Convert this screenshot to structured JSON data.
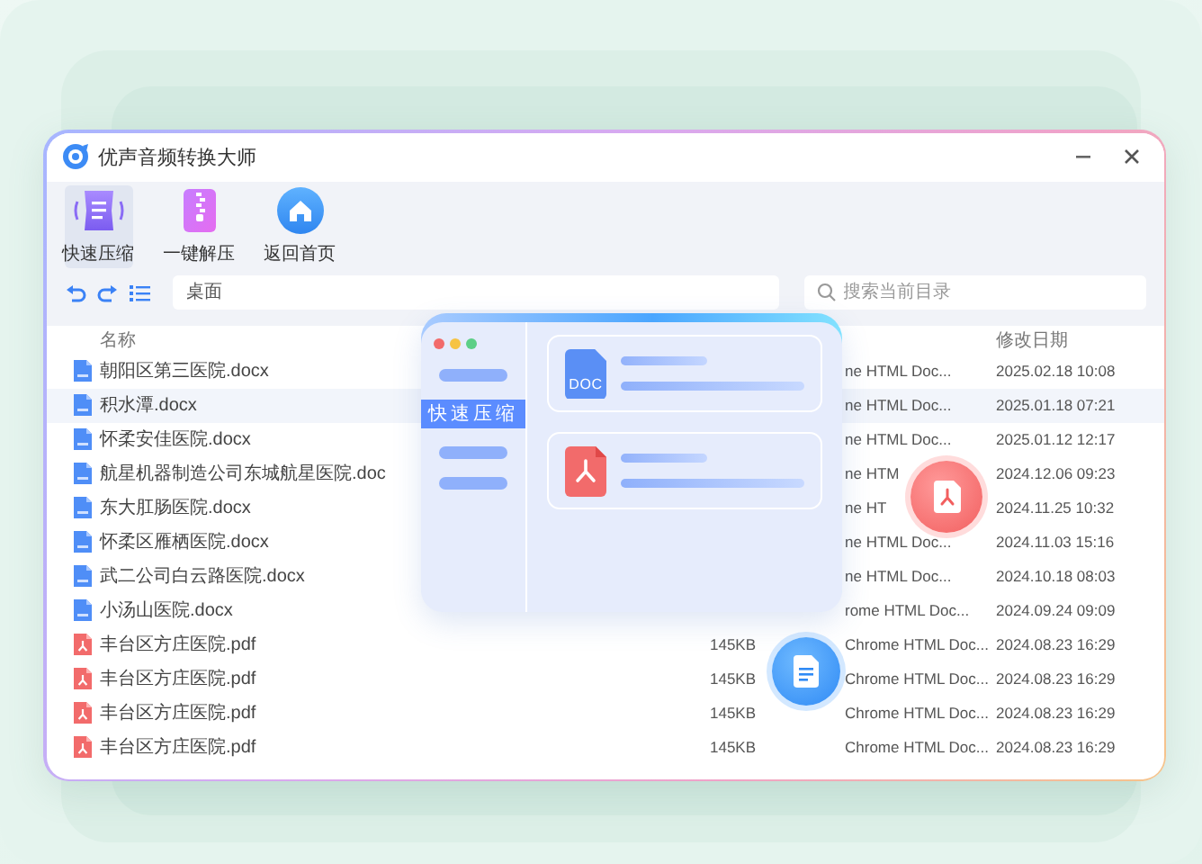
{
  "window": {
    "title": "优声音频转换大师"
  },
  "toolbar": [
    {
      "label": "快速压缩",
      "kind": "compress",
      "selected": true
    },
    {
      "label": "一键解压",
      "kind": "extract",
      "selected": false
    },
    {
      "label": "返回首页",
      "kind": "home",
      "selected": false
    }
  ],
  "path_field": {
    "value": "桌面"
  },
  "search": {
    "placeholder": "搜索当前目录"
  },
  "file_list": {
    "header": {
      "name": "名称",
      "date": "修改日期"
    },
    "rows": [
      {
        "kind": "doc",
        "name": "朝阳区第三医院.docx",
        "type": "ne HTML Doc...",
        "date": "2025.02.18 10:08",
        "selected": false
      },
      {
        "kind": "doc",
        "name": "积水潭.docx",
        "type": "ne HTML Doc...",
        "date": "2025.01.18 07:21",
        "selected": true
      },
      {
        "kind": "doc",
        "name": "怀柔安佳医院.docx",
        "type": "ne HTML Doc...",
        "date": "2025.01.12 12:17",
        "selected": false
      },
      {
        "kind": "doc",
        "name": "航星机器制造公司东城航星医院.doc",
        "type": "ne HTM",
        "date": "2024.12.06 09:23",
        "selected": false
      },
      {
        "kind": "doc",
        "name": "东大肛肠医院.docx",
        "type": "ne HT",
        "date": "2024.11.25 10:32",
        "selected": false
      },
      {
        "kind": "doc",
        "name": "怀柔区雁栖医院.docx",
        "type": "ne HTML Doc...",
        "date": "2024.11.03 15:16",
        "selected": false
      },
      {
        "kind": "doc",
        "name": "武二公司白云路医院.docx",
        "type": "ne HTML Doc...",
        "date": "2024.10.18 08:03",
        "selected": false
      },
      {
        "kind": "doc",
        "name": "小汤山医院.docx",
        "type": "rome HTML Doc...",
        "date": "2024.09.24 09:09",
        "selected": false
      },
      {
        "kind": "pdf",
        "name": "丰台区方庄医院.pdf",
        "size": "145KB",
        "type": "Chrome HTML Doc...",
        "date": "2024.08.23 16:29",
        "selected": false
      },
      {
        "kind": "pdf",
        "name": "丰台区方庄医院.pdf",
        "size": "145KB",
        "type": "Chrome HTML Doc...",
        "date": "2024.08.23 16:29",
        "selected": false
      },
      {
        "kind": "pdf",
        "name": "丰台区方庄医院.pdf",
        "size": "145KB",
        "type": "Chrome HTML Doc...",
        "date": "2024.08.23 16:29",
        "selected": false
      },
      {
        "kind": "pdf",
        "name": "丰台区方庄医院.pdf",
        "size": "145KB",
        "type": "Chrome HTML Doc...",
        "date": "2024.08.23 16:29",
        "selected": false
      }
    ]
  },
  "preview": {
    "sidebar_items": [
      {
        "kind": "bar",
        "selected": false
      },
      {
        "kind": "label",
        "label": "快速压缩",
        "selected": true
      },
      {
        "kind": "bar",
        "selected": false
      },
      {
        "kind": "bar",
        "selected": false
      }
    ],
    "cards": [
      {
        "kind": "doc",
        "badge": "DOC"
      },
      {
        "kind": "pdf"
      }
    ]
  },
  "floating_icons": [
    {
      "kind": "pdf"
    },
    {
      "kind": "doc"
    }
  ]
}
